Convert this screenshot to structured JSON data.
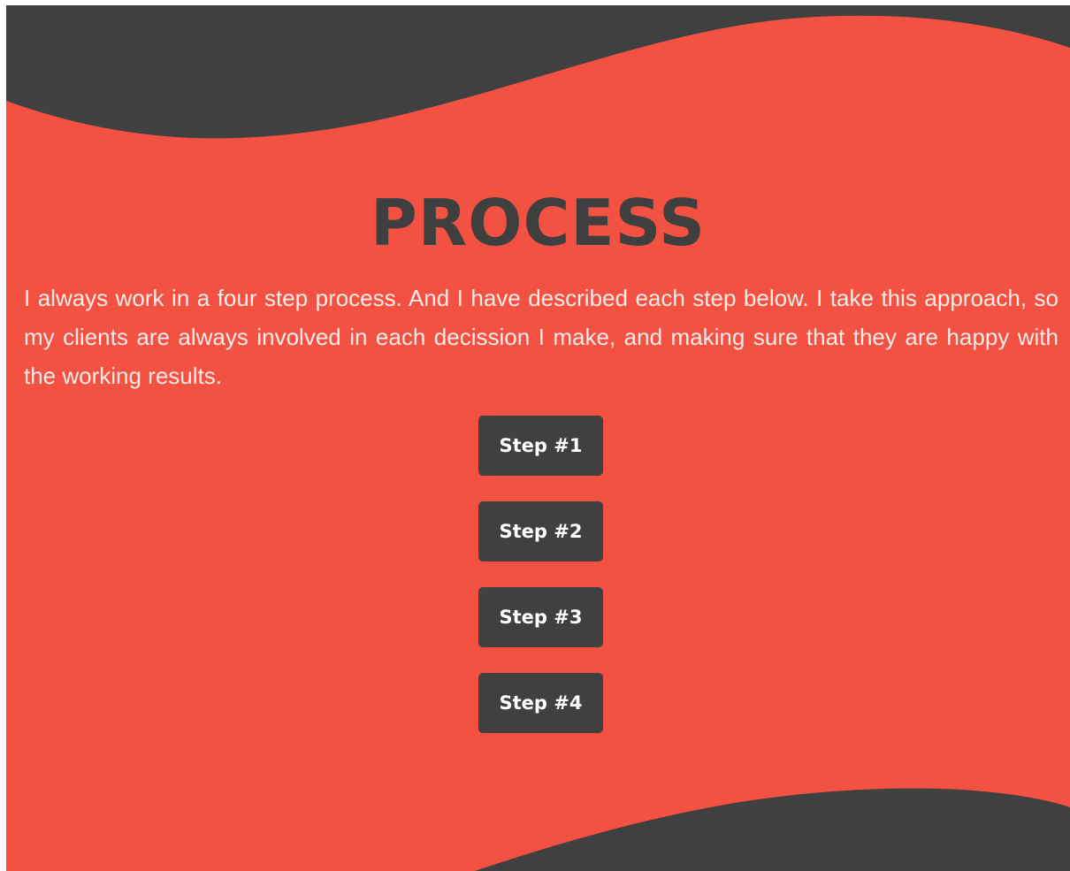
{
  "section": {
    "title": "PROCESS",
    "intro": "I always work in a four step process. And I have described each step below. I take this approach, so my clients are always involved in each decission I make, and making sure that they are happy with the working results."
  },
  "steps": [
    {
      "label": "Step #1"
    },
    {
      "label": "Step #2"
    },
    {
      "label": "Step #3"
    },
    {
      "label": "Step #4"
    }
  ],
  "colors": {
    "background": "#f35242",
    "dark": "#404040",
    "text_light": "#fdebe8"
  }
}
